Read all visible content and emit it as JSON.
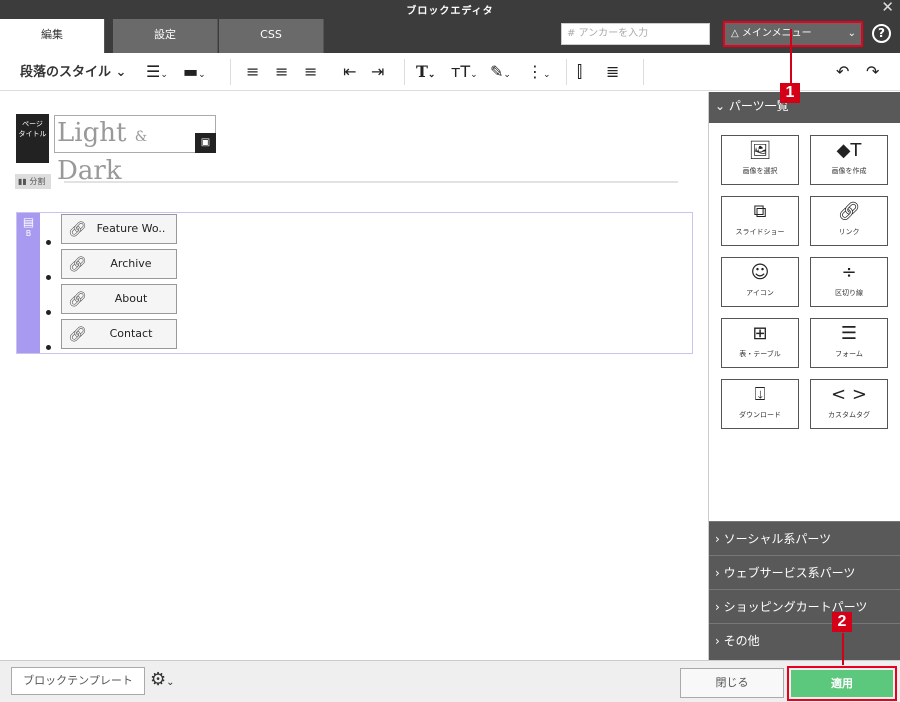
{
  "window": {
    "title": "ブロックエディタ",
    "close_glyph": "✕"
  },
  "tabs": [
    {
      "label": "編集",
      "active": true
    },
    {
      "label": "設定",
      "active": false
    },
    {
      "label": "CSS",
      "active": false
    }
  ],
  "anchor": {
    "placeholder": "# アンカーを入力"
  },
  "main_menu": {
    "label": "△ メインメニュー"
  },
  "help": {
    "glyph": "?"
  },
  "toolbar": {
    "style_label": "段落のスタイル ⌄"
  },
  "canvas": {
    "page_title_badge": "ページ\nタイトル",
    "logo": {
      "text1": "Light",
      "amp": "&",
      "text2": "Dark"
    },
    "divider_label": "分割",
    "list_block_label": "B",
    "links": [
      "Feature Wo..",
      "Archive",
      "About",
      "Contact"
    ]
  },
  "panel": {
    "header": "パーツ一覧",
    "parts": [
      {
        "label": "画像を選択",
        "icon": "image-icon"
      },
      {
        "label": "画像を作成",
        "icon": "shapes-text-icon"
      },
      {
        "label": "スライドショー",
        "icon": "slideshow-icon"
      },
      {
        "label": "リンク",
        "icon": "link-icon"
      },
      {
        "label": "アイコン",
        "icon": "smiley-icon"
      },
      {
        "label": "区切り線",
        "icon": "divider-icon"
      },
      {
        "label": "表・テーブル",
        "icon": "table-icon"
      },
      {
        "label": "フォーム",
        "icon": "form-icon"
      },
      {
        "label": "ダウンロード",
        "icon": "download-icon"
      },
      {
        "label": "カスタムタグ",
        "icon": "code-icon"
      }
    ],
    "categories": [
      "ソーシャル系パーツ",
      "ウェブサービス系パーツ",
      "ショッピングカートパーツ",
      "その他"
    ]
  },
  "footer": {
    "template_button": "ブロックテンプレート",
    "close_button": "閉じる",
    "apply_button": "適用"
  },
  "annotations": [
    "1",
    "2"
  ],
  "colors": {
    "accent_red": "#e8001c",
    "apply_green": "#5cc87e",
    "list_purple": "#a79af0",
    "dark_bar": "#3c3c3c"
  }
}
